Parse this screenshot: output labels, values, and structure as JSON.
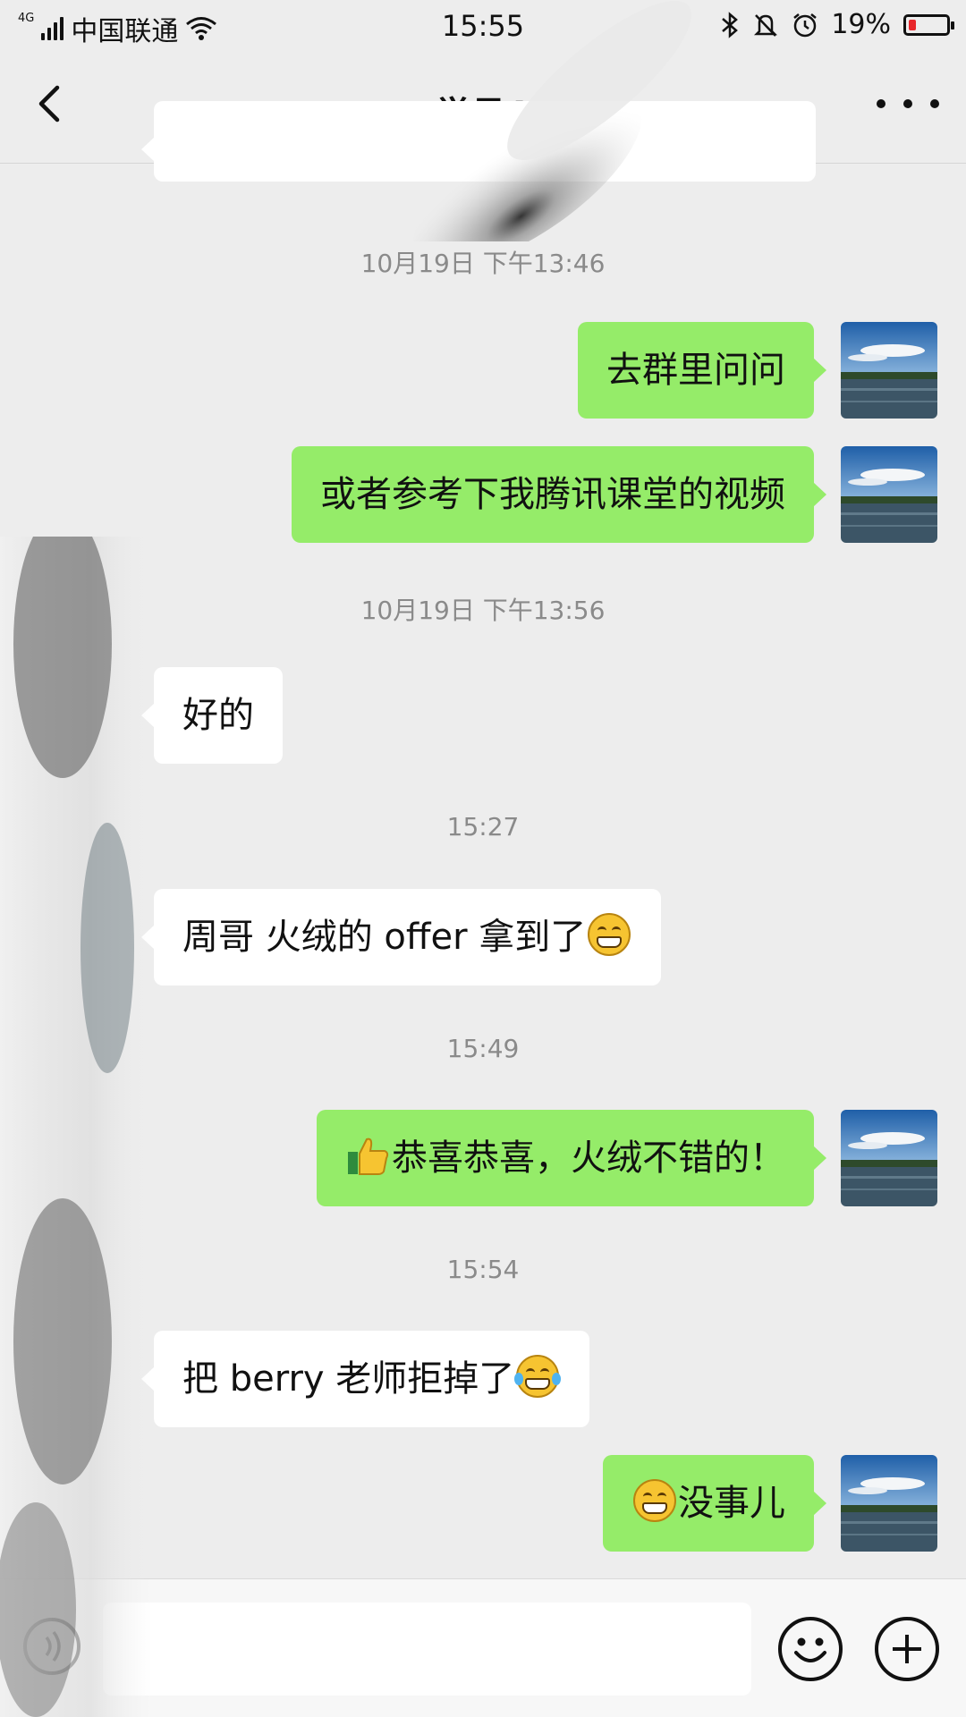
{
  "status_bar": {
    "network": "4G",
    "carrier": "中国联通",
    "time": "15:55",
    "battery": "19%",
    "battery_level": 0.19,
    "icons": [
      "signal-icon",
      "wifi-icon",
      "bluetooth-icon",
      "mute-bell-icon",
      "alarm-icon",
      "battery-icon"
    ]
  },
  "nav": {
    "title": "学员1",
    "back_icon": "chevron-left-icon",
    "more_icon": "more-dots-icon"
  },
  "messages": [
    {
      "type": "time",
      "text": "10月19日 下午13:46"
    },
    {
      "type": "out",
      "text": "去群里问问"
    },
    {
      "type": "out",
      "text": "或者参考下我腾讯课堂的视频"
    },
    {
      "type": "time",
      "text": "10月19日 下午13:56"
    },
    {
      "type": "in",
      "text": "好的"
    },
    {
      "type": "time",
      "text": "15:27"
    },
    {
      "type": "in",
      "text": "周哥 火绒的 offer 拿到了",
      "emoji_after": "grin-emoji"
    },
    {
      "type": "time",
      "text": "15:49"
    },
    {
      "type": "out",
      "text": "恭喜恭喜，火绒不错的！",
      "emoji_before": "thumbs-up-emoji"
    },
    {
      "type": "time",
      "text": "15:54"
    },
    {
      "type": "in",
      "text": "把 berry 老师拒掉了",
      "emoji_after": "laughing-tears-emoji"
    },
    {
      "type": "out",
      "text": "没事儿",
      "emoji_before": "grin-emoji"
    }
  ],
  "colors": {
    "background": "#ededed",
    "outgoing_bubble": "#95ec69",
    "incoming_bubble": "#ffffff",
    "battery_low": "#e8262b"
  },
  "input_bar": {
    "value": "",
    "icons": [
      "voice-icon",
      "emoji-icon",
      "plus-icon"
    ]
  }
}
